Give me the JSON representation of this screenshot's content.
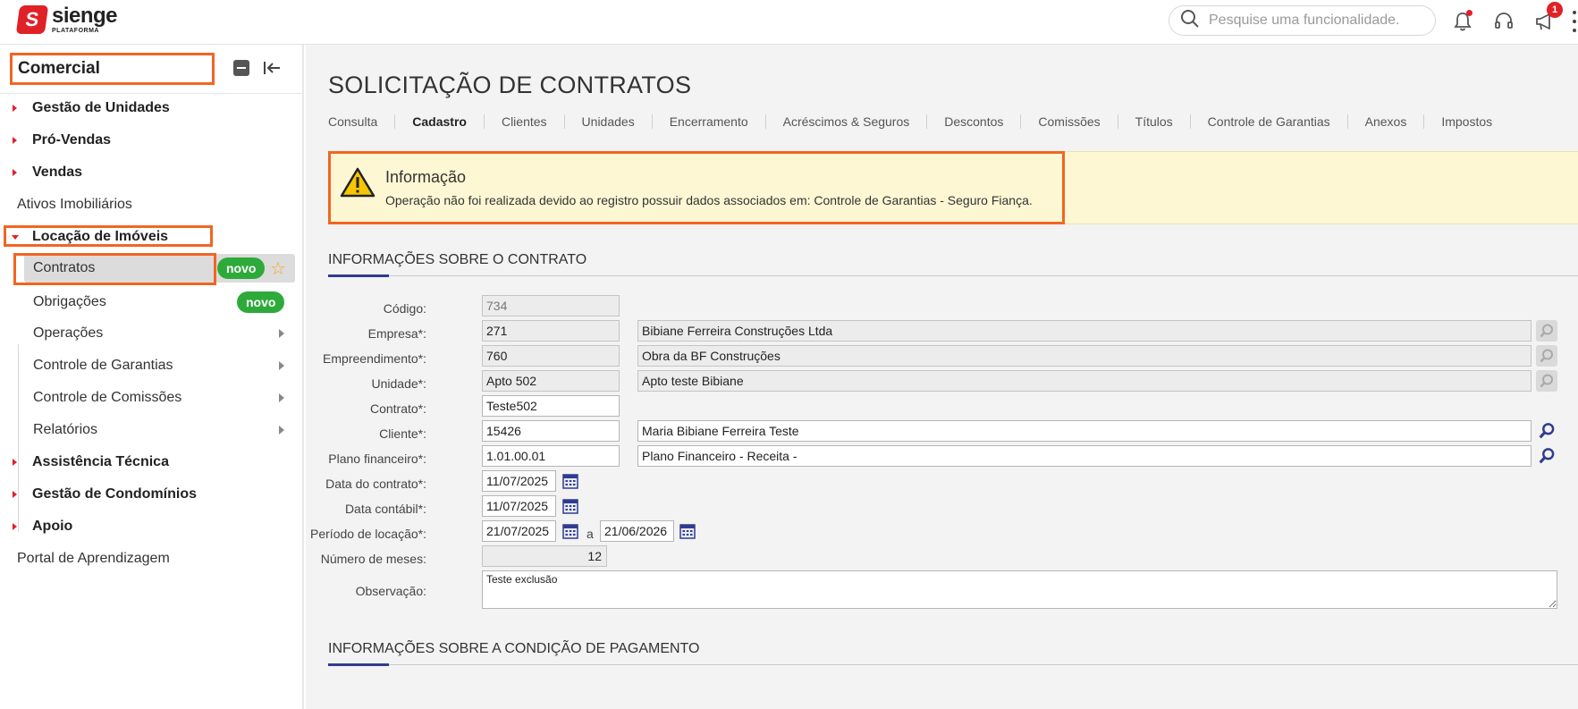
{
  "brand": {
    "mark": "S",
    "name": "sienge",
    "sub": "PLATAFORMA"
  },
  "header": {
    "search_placeholder": "Pesquise uma funcionalidade.",
    "notification_badge": "1"
  },
  "sidebar": {
    "title": "Comercial",
    "items": [
      {
        "label": "Gestão de Unidades"
      },
      {
        "label": "Pró-Vendas"
      },
      {
        "label": "Vendas"
      },
      {
        "label": "Ativos Imobiliários"
      },
      {
        "label": "Locação de Imóveis"
      },
      {
        "label": "Assistência Técnica"
      },
      {
        "label": "Gestão de Condomínios"
      },
      {
        "label": "Apoio"
      },
      {
        "label": "Portal de Aprendizagem"
      }
    ],
    "subitems": [
      {
        "label": "Contratos",
        "badge": "novo"
      },
      {
        "label": "Obrigações",
        "badge": "novo"
      },
      {
        "label": "Operações"
      },
      {
        "label": "Controle de Garantias"
      },
      {
        "label": "Controle de Comissões"
      },
      {
        "label": "Relatórios"
      }
    ]
  },
  "page": {
    "title": "SOLICITAÇÃO DE CONTRATOS",
    "tabs": [
      "Consulta",
      "Cadastro",
      "Clientes",
      "Unidades",
      "Encerramento",
      "Acréscimos & Seguros",
      "Descontos",
      "Comissões",
      "Títulos",
      "Controle de Garantias",
      "Anexos",
      "Impostos"
    ],
    "active_tab": "Cadastro"
  },
  "alert": {
    "title": "Informação",
    "message": "Operação não foi realizada devido ao registro possuir dados associados em: Controle de Garantias - Seguro Fiança."
  },
  "section1": {
    "title": "INFORMAÇÕES SOBRE O CONTRATO"
  },
  "section2": {
    "title": "INFORMAÇÕES SOBRE A CONDIÇÃO DE PAGAMENTO"
  },
  "form": {
    "codigo": {
      "label": "Código:",
      "value": "734"
    },
    "empresa": {
      "label": "Empresa*:",
      "code": "271",
      "name": "Bibiane Ferreira Construções Ltda"
    },
    "empreendimento": {
      "label": "Empreendimento*:",
      "code": "760",
      "name": "Obra da BF Construções"
    },
    "unidade": {
      "label": "Unidade*:",
      "code": "Apto 502",
      "name": "Apto teste Bibiane"
    },
    "contrato": {
      "label": "Contrato*:",
      "value": "Teste502"
    },
    "cliente": {
      "label": "Cliente*:",
      "code": "15426",
      "name": "Maria Bibiane Ferreira Teste"
    },
    "plano": {
      "label": "Plano financeiro*:",
      "code": "1.01.00.01",
      "name": "Plano Financeiro - Receita -"
    },
    "data_contrato": {
      "label": "Data do contrato*:",
      "value": "11/07/2025"
    },
    "data_contabil": {
      "label": "Data contábil*:",
      "value": "11/07/2025"
    },
    "periodo": {
      "label": "Período de locação*:",
      "start": "21/07/2025",
      "sep": "a",
      "end": "21/06/2026"
    },
    "meses": {
      "label": "Número de meses:",
      "value": "12"
    },
    "observacao": {
      "label": "Observação:",
      "value": "Teste exclusão"
    }
  },
  "colors": {
    "accent": "#f26522",
    "brand": "#e02127",
    "badge": "#2eaa3b",
    "section_accent": "#2f3c8f",
    "alert_bg": "#fdf7d3"
  }
}
